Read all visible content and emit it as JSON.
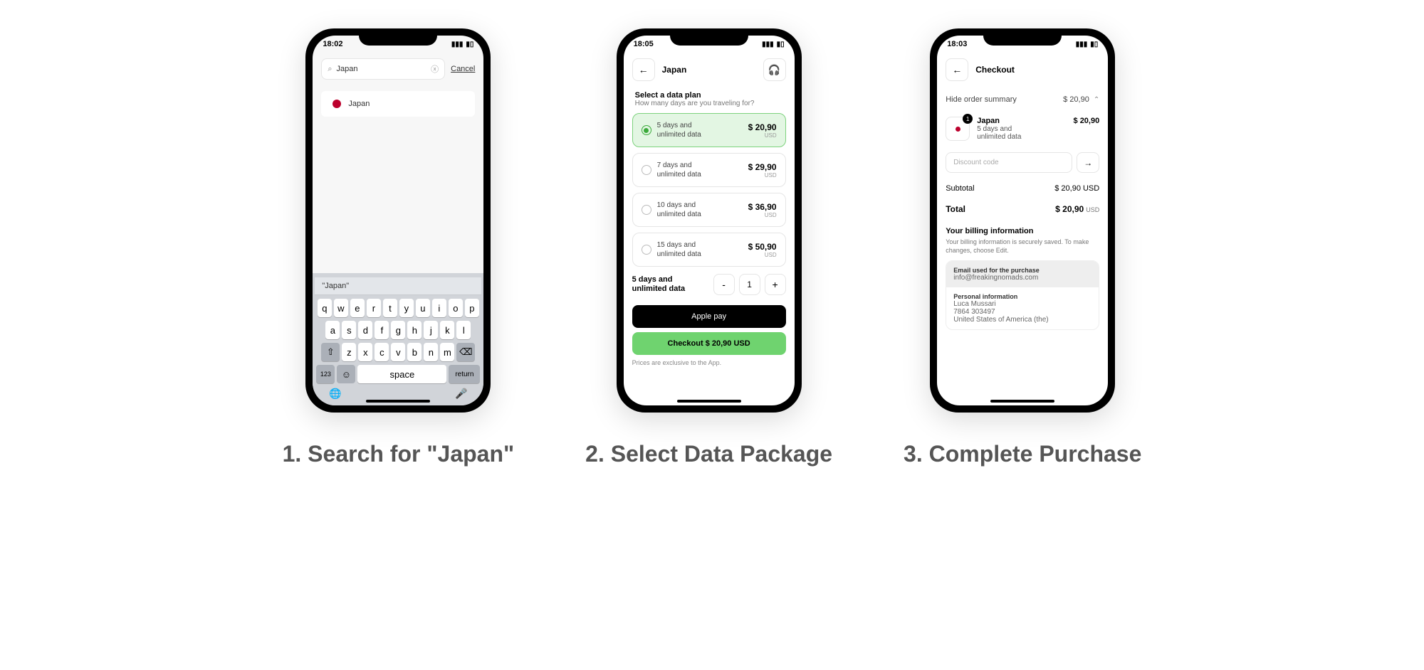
{
  "captions": {
    "c1": "1.  Search for \"Japan\"",
    "c2": "2.  Select Data Package",
    "c3": "3.  Complete Purchase"
  },
  "screen1": {
    "time": "18:02",
    "search_value": "Japan",
    "cancel": "Cancel",
    "result": "Japan",
    "keyboard": {
      "suggestion": "\"Japan\"",
      "row1": [
        "q",
        "w",
        "e",
        "r",
        "t",
        "y",
        "u",
        "i",
        "o",
        "p"
      ],
      "row2": [
        "a",
        "s",
        "d",
        "f",
        "g",
        "h",
        "j",
        "k",
        "l"
      ],
      "row3": [
        "z",
        "x",
        "c",
        "v",
        "b",
        "n",
        "m"
      ],
      "shift": "⇧",
      "backspace": "⌫",
      "number": "123",
      "emoji": "☺",
      "space": "space",
      "ret": "return",
      "globe": "🌐",
      "mic": "🎤"
    }
  },
  "screen2": {
    "time": "18:05",
    "title": "Japan",
    "section_title": "Select a data plan",
    "section_sub": "How many days are you traveling for?",
    "plans": [
      {
        "label1": "5 days and",
        "label2": "unlimited data",
        "price": "$ 20,90",
        "cur": "USD",
        "selected": true
      },
      {
        "label1": "7 days and",
        "label2": "unlimited data",
        "price": "$ 29,90",
        "cur": "USD",
        "selected": false
      },
      {
        "label1": "10 days and",
        "label2": "unlimited data",
        "price": "$ 36,90",
        "cur": "USD",
        "selected": false
      },
      {
        "label1": "15 days and",
        "label2": "unlimited data",
        "price": "$ 50,90",
        "cur": "USD",
        "selected": false
      }
    ],
    "qty_label1": "5 days and",
    "qty_label2": "unlimited data",
    "qty_minus": "-",
    "qty": "1",
    "qty_plus": "+",
    "apple_pay": " Apple pay",
    "checkout": "Checkout $ 20,90 USD",
    "footnote": "Prices are exclusive to the App."
  },
  "screen3": {
    "time": "18:03",
    "title": "Checkout",
    "summary_label": "Hide order summary",
    "summary_price": "$ 20,90",
    "item": {
      "badge": "1",
      "name": "Japan",
      "line1": "5 days and",
      "line2": "unlimited data",
      "price": "$ 20,90"
    },
    "discount_placeholder": "Discount code",
    "arrow": "→",
    "subtotal_label": "Subtotal",
    "subtotal_value": "$ 20,90 USD",
    "total_label": "Total",
    "total_value": "$ 20,90",
    "total_cur": "USD",
    "billing_title": "Your billing information",
    "billing_sub": "Your billing information is securely saved. To make changes, choose Edit.",
    "email_label": "Email used for the purchase",
    "email": "info@freakingnomads.com",
    "personal_label": "Personal information",
    "name": "Luca   Mussari",
    "phone": "7864 303497",
    "country": "United States of America (the)"
  }
}
